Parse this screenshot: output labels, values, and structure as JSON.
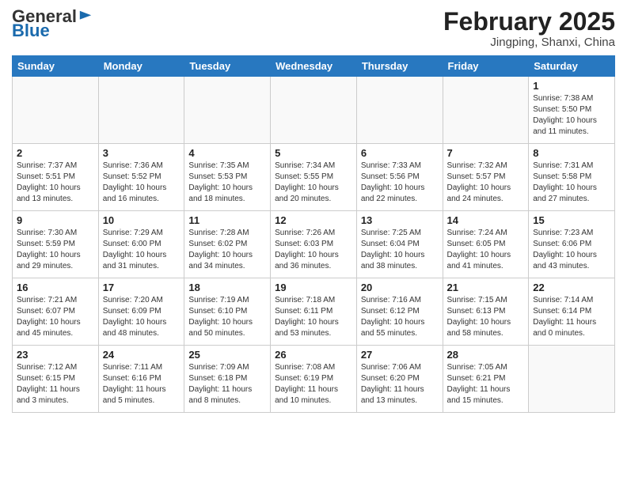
{
  "header": {
    "logo_general": "General",
    "logo_blue": "Blue",
    "month_year": "February 2025",
    "location": "Jingping, Shanxi, China"
  },
  "weekdays": [
    "Sunday",
    "Monday",
    "Tuesday",
    "Wednesday",
    "Thursday",
    "Friday",
    "Saturday"
  ],
  "weeks": [
    [
      {
        "day": "",
        "info": ""
      },
      {
        "day": "",
        "info": ""
      },
      {
        "day": "",
        "info": ""
      },
      {
        "day": "",
        "info": ""
      },
      {
        "day": "",
        "info": ""
      },
      {
        "day": "",
        "info": ""
      },
      {
        "day": "1",
        "info": "Sunrise: 7:38 AM\nSunset: 5:50 PM\nDaylight: 10 hours\nand 11 minutes."
      }
    ],
    [
      {
        "day": "2",
        "info": "Sunrise: 7:37 AM\nSunset: 5:51 PM\nDaylight: 10 hours\nand 13 minutes."
      },
      {
        "day": "3",
        "info": "Sunrise: 7:36 AM\nSunset: 5:52 PM\nDaylight: 10 hours\nand 16 minutes."
      },
      {
        "day": "4",
        "info": "Sunrise: 7:35 AM\nSunset: 5:53 PM\nDaylight: 10 hours\nand 18 minutes."
      },
      {
        "day": "5",
        "info": "Sunrise: 7:34 AM\nSunset: 5:55 PM\nDaylight: 10 hours\nand 20 minutes."
      },
      {
        "day": "6",
        "info": "Sunrise: 7:33 AM\nSunset: 5:56 PM\nDaylight: 10 hours\nand 22 minutes."
      },
      {
        "day": "7",
        "info": "Sunrise: 7:32 AM\nSunset: 5:57 PM\nDaylight: 10 hours\nand 24 minutes."
      },
      {
        "day": "8",
        "info": "Sunrise: 7:31 AM\nSunset: 5:58 PM\nDaylight: 10 hours\nand 27 minutes."
      }
    ],
    [
      {
        "day": "9",
        "info": "Sunrise: 7:30 AM\nSunset: 5:59 PM\nDaylight: 10 hours\nand 29 minutes."
      },
      {
        "day": "10",
        "info": "Sunrise: 7:29 AM\nSunset: 6:00 PM\nDaylight: 10 hours\nand 31 minutes."
      },
      {
        "day": "11",
        "info": "Sunrise: 7:28 AM\nSunset: 6:02 PM\nDaylight: 10 hours\nand 34 minutes."
      },
      {
        "day": "12",
        "info": "Sunrise: 7:26 AM\nSunset: 6:03 PM\nDaylight: 10 hours\nand 36 minutes."
      },
      {
        "day": "13",
        "info": "Sunrise: 7:25 AM\nSunset: 6:04 PM\nDaylight: 10 hours\nand 38 minutes."
      },
      {
        "day": "14",
        "info": "Sunrise: 7:24 AM\nSunset: 6:05 PM\nDaylight: 10 hours\nand 41 minutes."
      },
      {
        "day": "15",
        "info": "Sunrise: 7:23 AM\nSunset: 6:06 PM\nDaylight: 10 hours\nand 43 minutes."
      }
    ],
    [
      {
        "day": "16",
        "info": "Sunrise: 7:21 AM\nSunset: 6:07 PM\nDaylight: 10 hours\nand 45 minutes."
      },
      {
        "day": "17",
        "info": "Sunrise: 7:20 AM\nSunset: 6:09 PM\nDaylight: 10 hours\nand 48 minutes."
      },
      {
        "day": "18",
        "info": "Sunrise: 7:19 AM\nSunset: 6:10 PM\nDaylight: 10 hours\nand 50 minutes."
      },
      {
        "day": "19",
        "info": "Sunrise: 7:18 AM\nSunset: 6:11 PM\nDaylight: 10 hours\nand 53 minutes."
      },
      {
        "day": "20",
        "info": "Sunrise: 7:16 AM\nSunset: 6:12 PM\nDaylight: 10 hours\nand 55 minutes."
      },
      {
        "day": "21",
        "info": "Sunrise: 7:15 AM\nSunset: 6:13 PM\nDaylight: 10 hours\nand 58 minutes."
      },
      {
        "day": "22",
        "info": "Sunrise: 7:14 AM\nSunset: 6:14 PM\nDaylight: 11 hours\nand 0 minutes."
      }
    ],
    [
      {
        "day": "23",
        "info": "Sunrise: 7:12 AM\nSunset: 6:15 PM\nDaylight: 11 hours\nand 3 minutes."
      },
      {
        "day": "24",
        "info": "Sunrise: 7:11 AM\nSunset: 6:16 PM\nDaylight: 11 hours\nand 5 minutes."
      },
      {
        "day": "25",
        "info": "Sunrise: 7:09 AM\nSunset: 6:18 PM\nDaylight: 11 hours\nand 8 minutes."
      },
      {
        "day": "26",
        "info": "Sunrise: 7:08 AM\nSunset: 6:19 PM\nDaylight: 11 hours\nand 10 minutes."
      },
      {
        "day": "27",
        "info": "Sunrise: 7:06 AM\nSunset: 6:20 PM\nDaylight: 11 hours\nand 13 minutes."
      },
      {
        "day": "28",
        "info": "Sunrise: 7:05 AM\nSunset: 6:21 PM\nDaylight: 11 hours\nand 15 minutes."
      },
      {
        "day": "",
        "info": ""
      }
    ]
  ]
}
